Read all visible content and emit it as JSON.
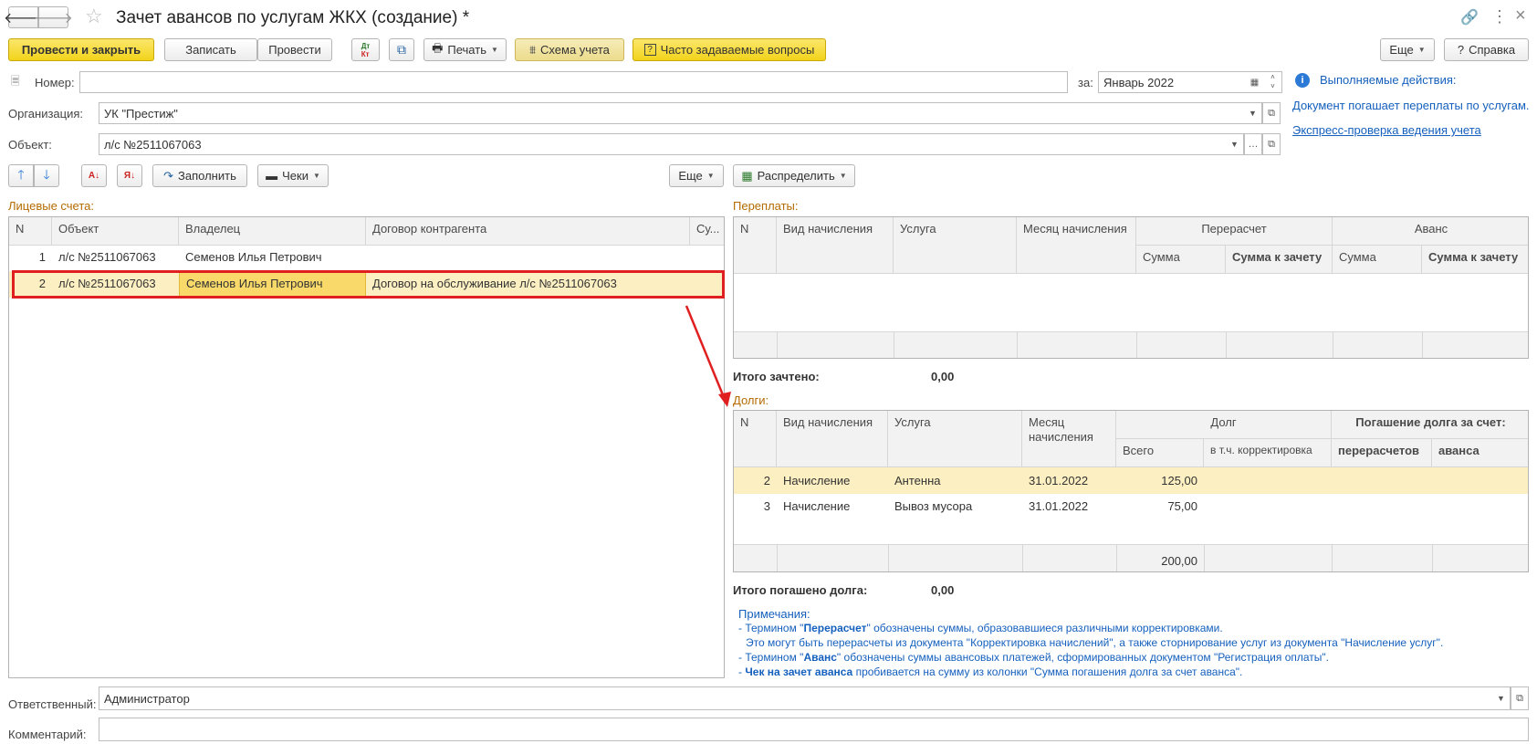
{
  "window": {
    "title": "Зачет авансов по услугам ЖКХ (создание) *"
  },
  "toolbar": {
    "post_close": "Провести и закрыть",
    "save": "Записать",
    "post": "Провести",
    "print": "Печать",
    "scheme": "Схема учета",
    "faq": "Часто задаваемые вопросы",
    "more": "Еще",
    "help": "Справка"
  },
  "form": {
    "number_label": "Номер:",
    "number_value": "",
    "date_label": "за:",
    "date_value": "Январь 2022",
    "org_label": "Организация:",
    "org_value": "УК \"Престиж\"",
    "object_label": "Объект:",
    "object_value": "л/с №2511067063"
  },
  "info": {
    "actions_link": "Выполняемые действия:",
    "description": "Документ погашает переплаты по услугам.",
    "express_check": "Экспресс-проверка ведения учета"
  },
  "left_toolbar": {
    "fill": "Заполнить",
    "checks": "Чеки",
    "more": "Еще"
  },
  "accounts": {
    "section_title": "Лицевые счета:",
    "columns": [
      "N",
      "Объект",
      "Владелец",
      "Договор контрагента",
      "Су..."
    ],
    "rows": [
      {
        "n": "1",
        "object": "л/с №2511067063",
        "owner": "Семенов Илья Петрович",
        "contract": ""
      },
      {
        "n": "2",
        "object": "л/с №2511067063",
        "owner": "Семенов Илья Петрович",
        "contract": "Договор на обслуживание л/с №2511067063"
      }
    ]
  },
  "distribute_button": "Распределить",
  "overpayments": {
    "section_title": "Переплаты:",
    "columns": {
      "n": "N",
      "kind": "Вид начисления",
      "service": "Услуга",
      "month": "Месяц начисления",
      "recalc": "Перерасчет",
      "advance": "Аванс",
      "sum": "Сумма",
      "sum_offset": "Сумма к зачету"
    },
    "total_label": "Итого зачтено:",
    "total_value": "0,00"
  },
  "debts": {
    "section_title": "Долги:",
    "columns": {
      "n": "N",
      "kind": "Вид начисления",
      "service": "Услуга",
      "month": "Месяц начисления",
      "debt": "Долг",
      "total": "Всего",
      "incl_adj": "в т.ч. корректировка",
      "repay": "Погашение долга за счет:",
      "recalcs": "перерасчетов",
      "advance": "аванса"
    },
    "rows": [
      {
        "n": "2",
        "kind": "Начисление",
        "service": "Антенна",
        "month": "31.01.2022",
        "total": "125,00"
      },
      {
        "n": "3",
        "kind": "Начисление",
        "service": "Вывоз мусора",
        "month": "31.01.2022",
        "total": "75,00"
      }
    ],
    "footer_total": "200,00",
    "total_label": "Итого погашено долга:",
    "total_value": "0,00"
  },
  "notes": {
    "title": "Примечания:",
    "l1_pre": "- Термином \"",
    "l1_bold": "Перерасчет",
    "l1_post": "\" обозначены суммы, образовавшиеся различными корректировками.",
    "l2": "Это могут быть перерасчеты из документа \"Корректировка начислений\", а также сторнирование услуг из документа \"Начисление услуг\".",
    "l3_pre": "- Термином \"",
    "l3_bold": "Аванс",
    "l3_post": "\" обозначены суммы авансовых платежей, сформированных документом \"Регистрация оплаты\".",
    "l4_pre": "- ",
    "l4_bold": "Чек на зачет аванса",
    "l4_post": " пробивается на сумму из колонки \"Сумма погашения долга за счет аванса\"."
  },
  "footer": {
    "responsible_label": "Ответственный:",
    "responsible_value": "Администратор",
    "comment_label": "Комментарий:",
    "comment_value": ""
  }
}
